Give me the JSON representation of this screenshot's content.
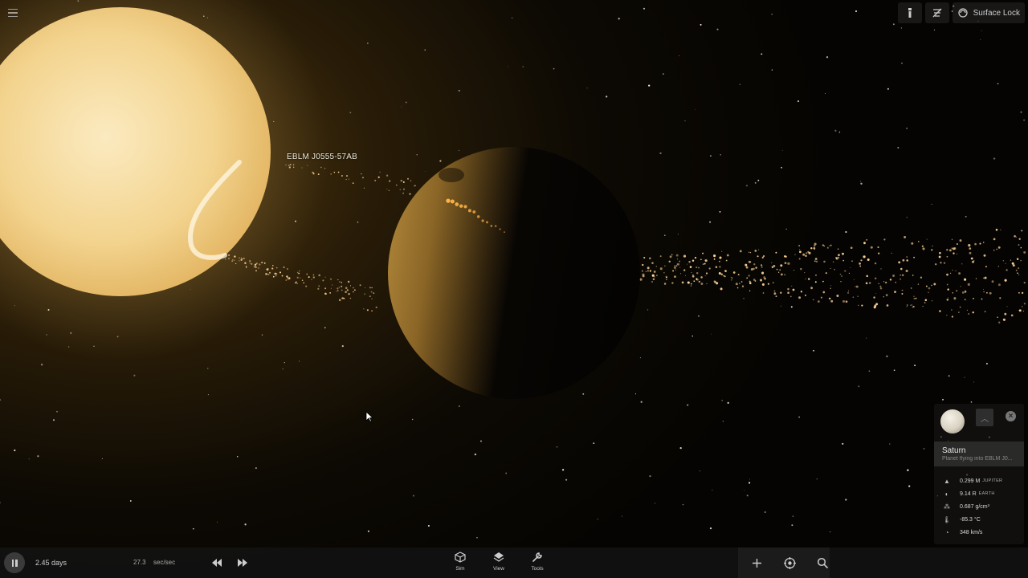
{
  "scene": {
    "object_label": "EBLM J0555-57AB"
  },
  "top_toolbar": {
    "surface_lock_label": "Surface Lock"
  },
  "info_panel": {
    "name": "Saturn",
    "description": "Planet flying into EBLM J0...",
    "stats": [
      {
        "value": "0.299 M",
        "unit": "JUPITER",
        "icon": "mass-icon"
      },
      {
        "value": "9.14 R",
        "unit": "EARTH",
        "icon": "radius-icon"
      },
      {
        "value": "0.687 g/cm³",
        "unit": "",
        "icon": "density-icon"
      },
      {
        "value": "-85.3 °C",
        "unit": "",
        "icon": "temperature-icon"
      },
      {
        "value": "348 km/s",
        "unit": "",
        "icon": "speed-icon"
      }
    ]
  },
  "bottom_bar": {
    "elapsed_time": "2.45 days",
    "time_rate_value": "27.3",
    "time_rate_unit": "sec/sec",
    "nav": [
      {
        "label": "Sim",
        "icon": "cube-icon"
      },
      {
        "label": "View",
        "icon": "layers-icon"
      },
      {
        "label": "Tools",
        "icon": "wrench-icon"
      }
    ]
  },
  "colors": {
    "star": "#f3d89a",
    "background": "#050402",
    "ring_particles": "#ffd59a"
  }
}
